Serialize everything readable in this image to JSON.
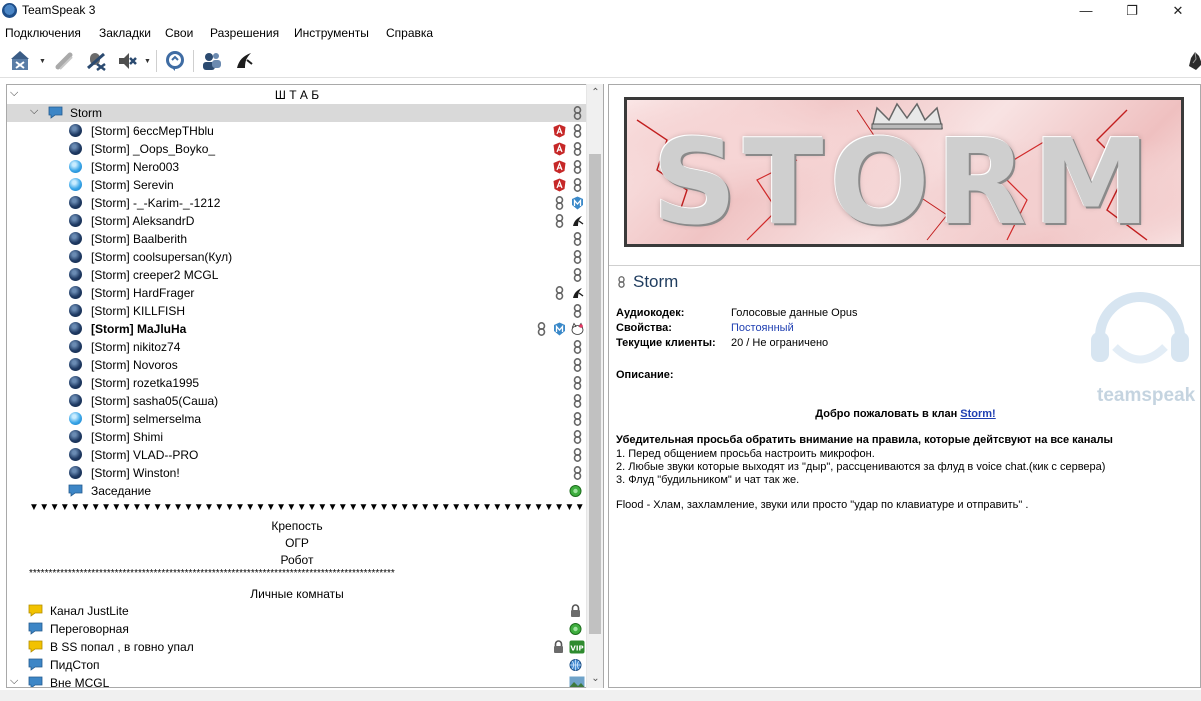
{
  "window": {
    "title": "TeamSpeak 3",
    "minimize": "—",
    "maximize": "❐",
    "close": "✕"
  },
  "menu": [
    "Подключения",
    "Закладки",
    "Свои",
    "Разрешения",
    "Инструменты",
    "Справка"
  ],
  "toolbar": {
    "icons": [
      "connect-icon",
      "disconnect-icon",
      "mute-mic-icon",
      "mute-speakers-icon",
      "away-status-icon",
      "contacts-icon",
      "hotkey-icon"
    ]
  },
  "tree": {
    "server": "Ш Т А Б",
    "channel": "Storm",
    "users": [
      {
        "name": "[Storm] 6ессМерТНblu",
        "ball": "dark",
        "badges": [
          "angular",
          "chain"
        ]
      },
      {
        "name": "[Storm] _Oops_Boyko_",
        "ball": "dark",
        "badges": [
          "angular",
          "chain"
        ]
      },
      {
        "name": "[Storm] Nero003",
        "ball": "light",
        "badges": [
          "angular",
          "chain"
        ]
      },
      {
        "name": "[Storm] Serevin",
        "ball": "light",
        "badges": [
          "angular",
          "chain"
        ]
      },
      {
        "name": "[Storm] -_-Karim-_-1212",
        "ball": "dark",
        "badges": [
          "chain",
          "m-badge"
        ]
      },
      {
        "name": "[Storm] AleksandrD",
        "ball": "dark",
        "badges": [
          "chain",
          "wolf"
        ]
      },
      {
        "name": "[Storm] Baalberith",
        "ball": "dark",
        "badges": [
          "chain"
        ]
      },
      {
        "name": "[Storm] coolsupersan(Кул)",
        "ball": "dark",
        "badges": [
          "chain"
        ]
      },
      {
        "name": "[Storm] creeper2 MCGL",
        "ball": "dark",
        "badges": [
          "chain"
        ]
      },
      {
        "name": "[Storm] HardFrager",
        "ball": "dark",
        "badges": [
          "chain",
          "wolf"
        ]
      },
      {
        "name": "[Storm] KILLFISH",
        "ball": "dark",
        "badges": [
          "chain"
        ]
      },
      {
        "name": "[Storm] MaJluHa",
        "ball": "dark",
        "bold": true,
        "badges": [
          "chain",
          "m-badge",
          "kitty"
        ]
      },
      {
        "name": "[Storm] nikitoz74",
        "ball": "dark",
        "badges": [
          "chain"
        ]
      },
      {
        "name": "[Storm] Novoros",
        "ball": "dark",
        "badges": [
          "chain"
        ]
      },
      {
        "name": "[Storm] rozetka1995",
        "ball": "dark",
        "badges": [
          "chain"
        ]
      },
      {
        "name": "[Storm] sasha05(Саша)",
        "ball": "dark",
        "badges": [
          "chain"
        ]
      },
      {
        "name": "[Storm] selmerselma",
        "ball": "light",
        "badges": [
          "chain"
        ]
      },
      {
        "name": "[Storm] Shimi",
        "ball": "dark",
        "badges": [
          "chain"
        ]
      },
      {
        "name": "[Storm] VLAD--PRO",
        "ball": "dark",
        "badges": [
          "chain"
        ]
      },
      {
        "name": "[Storm] Winston!",
        "ball": "dark",
        "badges": [
          "chain"
        ]
      }
    ],
    "subchannel": "Заседание",
    "separator_triangles": "▼▼▼▼▼▼▼▼▼▼▼▼▼▼▼▼▼▼▼▼▼▼▼▼▼▼▼▼▼▼▼▼▼▼▼▼▼▼▼▼▼▼▼▼▼▼▼▼▼▼▼▼▼▼▼▼▼▼▼▼▼▼",
    "spacers": [
      "Крепость",
      "ОГР",
      "Робот"
    ],
    "separator_stars": "**********************************************************************************************",
    "private_header": "Личные комнаты",
    "private_channels": [
      {
        "name": "Канал JustLite",
        "color": "yellow",
        "badges": [
          "lock"
        ]
      },
      {
        "name": "Переговорная",
        "color": "blue",
        "badges": [
          "green-dot"
        ]
      },
      {
        "name": "В SS попал , в говно упал",
        "color": "yellow",
        "badges": [
          "lock",
          "vip"
        ]
      },
      {
        "name": "ПидСтоп",
        "color": "blue",
        "badges": [
          "globe"
        ]
      },
      {
        "name": "Вне MCGL",
        "color": "blue",
        "badges": [
          "image"
        ]
      }
    ]
  },
  "info": {
    "banner_text": "STORM",
    "channel_title": "Storm",
    "fields": [
      {
        "key": "Аудиокодек:",
        "value": "Голосовые данные Opus",
        "link": false
      },
      {
        "key": "Свойства:",
        "value": "Постоянный",
        "link": true
      },
      {
        "key": "Текущие клиенты:",
        "value": "20 / Не ограничено",
        "link": false
      }
    ],
    "description_label": "Описание:",
    "welcome_prefix": "Добро пожаловать в клан ",
    "welcome_link": "Storm!",
    "rules_title": "Убедительная просьба обратить внимание на правила, которые дейтсвуют на все каналы",
    "rules": [
      "1. Перед общением просьба настроить микрофон.",
      "2. Любые звуки которые выходят из \"дыр\", рассцениваются за флуд в voice chat.(кик с сервера)",
      "3. Флуд \"будильником\"  и чат так же."
    ],
    "flood_note": "Flood - Хлам, захламление, звуки или просто \"удар по клавиатуре и отправить\" .",
    "logo_text": "teamspeak"
  },
  "colors": {
    "link": "#1f3fb2",
    "title": "#1f3c5e",
    "selection": "#d9d9d9"
  }
}
